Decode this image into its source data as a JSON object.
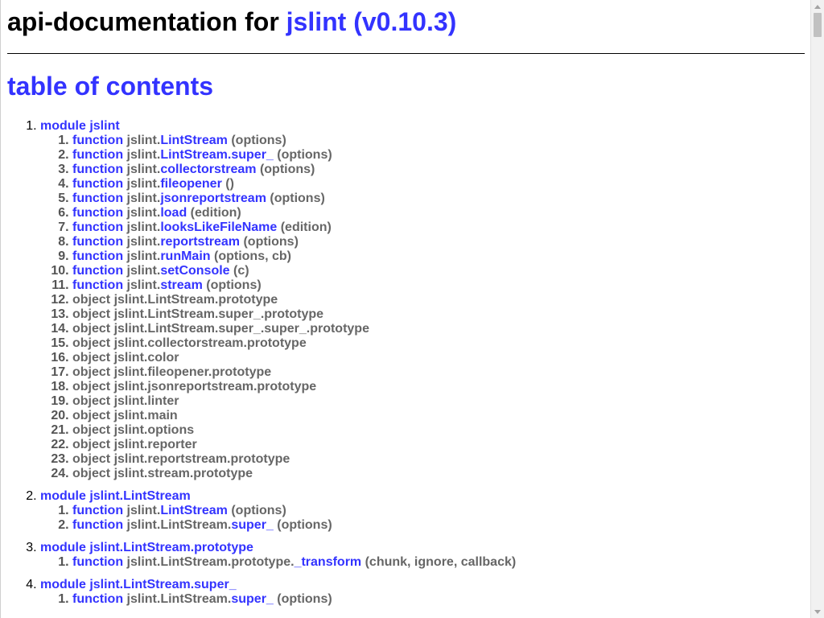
{
  "header": {
    "title_prefix": "api-documentation for ",
    "title_link": "jslint (v0.10.3)"
  },
  "toc": {
    "heading": "table of contents",
    "modules": [
      {
        "label": "module jslint",
        "members": [
          {
            "kind": "function",
            "prefix": "jslint.",
            "name": "LintStream",
            "sig": " (options)"
          },
          {
            "kind": "function",
            "prefix": "jslint.",
            "name": "LintStream.super_",
            "sig": " (options)"
          },
          {
            "kind": "function",
            "prefix": "jslint.",
            "name": "collectorstream",
            "sig": " (options)"
          },
          {
            "kind": "function",
            "prefix": "jslint.",
            "name": "fileopener",
            "sig": " ()"
          },
          {
            "kind": "function",
            "prefix": "jslint.",
            "name": "jsonreportstream",
            "sig": " (options)"
          },
          {
            "kind": "function",
            "prefix": "jslint.",
            "name": "load",
            "sig": " (edition)"
          },
          {
            "kind": "function",
            "prefix": "jslint.",
            "name": "looksLikeFileName",
            "sig": " (edition)"
          },
          {
            "kind": "function",
            "prefix": "jslint.",
            "name": "reportstream",
            "sig": " (options)"
          },
          {
            "kind": "function",
            "prefix": "jslint.",
            "name": "runMain",
            "sig": " (options, cb)"
          },
          {
            "kind": "function",
            "prefix": "jslint.",
            "name": "setConsole",
            "sig": " (c)"
          },
          {
            "kind": "function",
            "prefix": "jslint.",
            "name": "stream",
            "sig": " (options)"
          },
          {
            "kind": "object",
            "text": "object jslint.LintStream.prototype"
          },
          {
            "kind": "object",
            "text": "object jslint.LintStream.super_.prototype"
          },
          {
            "kind": "object",
            "text": "object jslint.LintStream.super_.super_.prototype"
          },
          {
            "kind": "object",
            "text": "object jslint.collectorstream.prototype"
          },
          {
            "kind": "object",
            "text": "object jslint.color"
          },
          {
            "kind": "object",
            "text": "object jslint.fileopener.prototype"
          },
          {
            "kind": "object",
            "text": "object jslint.jsonreportstream.prototype"
          },
          {
            "kind": "object",
            "text": "object jslint.linter"
          },
          {
            "kind": "object",
            "text": "object jslint.main"
          },
          {
            "kind": "object",
            "text": "object jslint.options"
          },
          {
            "kind": "object",
            "text": "object jslint.reporter"
          },
          {
            "kind": "object",
            "text": "object jslint.reportstream.prototype"
          },
          {
            "kind": "object",
            "text": "object jslint.stream.prototype"
          }
        ]
      },
      {
        "label": "module jslint.LintStream",
        "members": [
          {
            "kind": "function",
            "prefix": "jslint.",
            "name": "LintStream",
            "sig": " (options)"
          },
          {
            "kind": "function",
            "prefix": "jslint.LintStream.",
            "name": "super_",
            "sig": " (options)"
          }
        ]
      },
      {
        "label": "module jslint.LintStream.prototype",
        "members": [
          {
            "kind": "function",
            "prefix": "jslint.LintStream.prototype.",
            "name": "_transform",
            "sig": " (chunk, ignore, callback)"
          }
        ]
      },
      {
        "label": "module jslint.LintStream.super_",
        "members": [
          {
            "kind": "function",
            "prefix": "jslint.LintStream.",
            "name": "super_",
            "sig": " (options)"
          }
        ]
      }
    ]
  },
  "keyword_function": "function",
  "colors": {
    "link": "#3333ff",
    "muted": "#666666",
    "text": "#000000"
  },
  "icons": {
    "scroll_up": "scroll-up-arrow-icon",
    "scroll_down": "scroll-down-arrow-icon"
  }
}
